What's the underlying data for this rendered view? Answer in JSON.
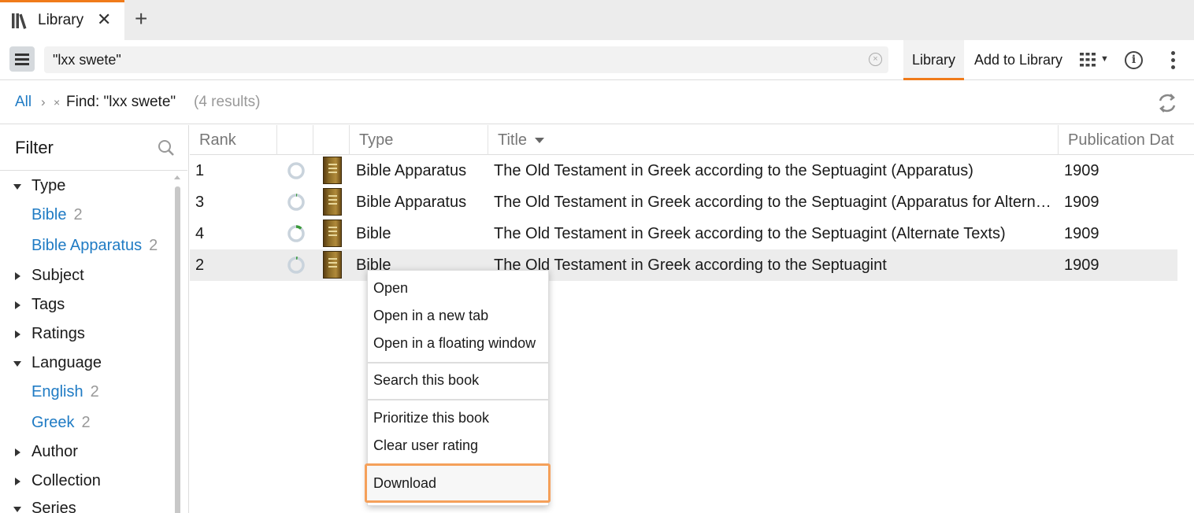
{
  "tab": {
    "label": "Library",
    "close": "✕",
    "new_tab": "+"
  },
  "toolbar": {
    "search_value": "\"lxx swete\"",
    "library_label": "Library",
    "add_label": "Add to Library",
    "info_glyph": "i"
  },
  "breadcrumb": {
    "all": "All",
    "sep": "›",
    "remove": "×",
    "find": "Find: \"lxx swete\"",
    "count": "(4 results)"
  },
  "filter": {
    "title": "Filter",
    "groups": [
      {
        "label": "Type",
        "expanded": true
      },
      {
        "label": "Subject",
        "expanded": false
      },
      {
        "label": "Tags",
        "expanded": false
      },
      {
        "label": "Ratings",
        "expanded": false
      },
      {
        "label": "Language",
        "expanded": true
      },
      {
        "label": "Author",
        "expanded": false
      },
      {
        "label": "Collection",
        "expanded": false
      },
      {
        "label": "Series",
        "expanded": true
      }
    ],
    "type_values": [
      {
        "value": "Bible",
        "count": "2"
      },
      {
        "value": "Bible Apparatus",
        "count": "2"
      }
    ],
    "language_values": [
      {
        "value": "English",
        "count": "2"
      },
      {
        "value": "Greek",
        "count": "2"
      }
    ]
  },
  "table": {
    "headers": {
      "rank": "Rank",
      "type": "Type",
      "title": "Title",
      "pubdate": "Publication Dat"
    },
    "rows": [
      {
        "rank": "1",
        "type": "Bible Apparatus",
        "title": "The Old Testament in Greek according to the Septuagint (Apparatus)",
        "date": "1909",
        "progress": 0
      },
      {
        "rank": "3",
        "type": "Bible Apparatus",
        "title": "The Old Testament in Greek according to the Septuagint (Apparatus for Alternate Texts)",
        "date": "1909",
        "progress": 0.02
      },
      {
        "rank": "4",
        "type": "Bible",
        "title": "The Old Testament in Greek according to the Septuagint (Alternate Texts)",
        "date": "1909",
        "progress": 0.12
      },
      {
        "rank": "2",
        "type": "Bible",
        "title": "The Old Testament in Greek according to the Septuagint",
        "date": "1909",
        "progress": 0.03
      }
    ]
  },
  "context_menu": {
    "open": "Open",
    "open_new_tab": "Open in a new tab",
    "open_floating": "Open in a floating window",
    "search_book": "Search this book",
    "prioritize": "Prioritize this book",
    "clear_rating": "Clear user rating",
    "download": "Download"
  },
  "colors": {
    "accent": "#f07b1a",
    "link": "#1f7bc4",
    "highlight": "#f5a05a",
    "progress": "#3a9a3a"
  }
}
